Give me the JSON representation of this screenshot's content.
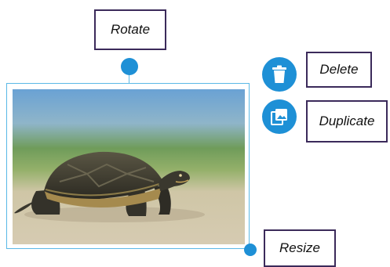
{
  "labels": {
    "rotate": "Rotate",
    "delete": "Delete",
    "duplicate": "Duplicate",
    "resize": "Resize"
  },
  "icons": {
    "delete": "trash-icon",
    "duplicate": "image-copy-icon",
    "rotate_handle": "rotate-handle",
    "resize_handle": "resize-handle"
  },
  "colors": {
    "accent": "#1e90d6",
    "selection_border": "#5ab8e6",
    "label_border": "#3b2a5a"
  }
}
